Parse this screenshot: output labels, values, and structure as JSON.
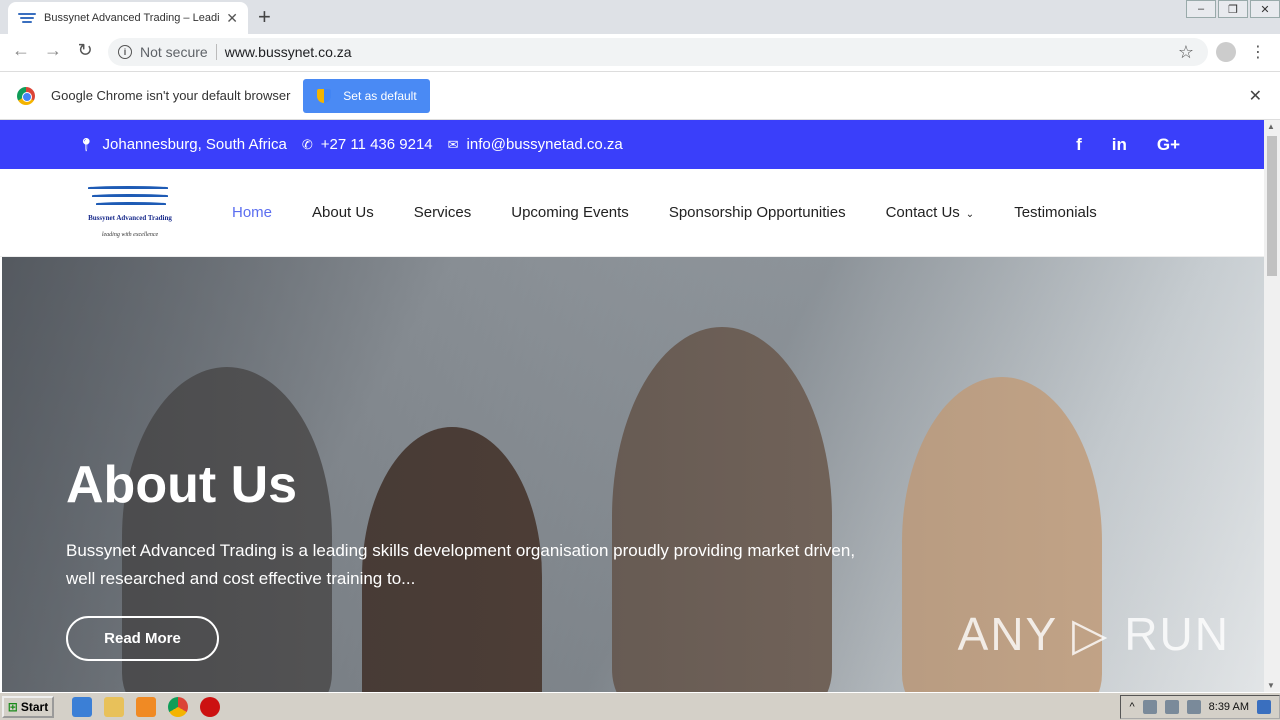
{
  "browser": {
    "tab_title": "Bussynet Advanced Trading – Leadi",
    "tab_close": "✕",
    "new_tab": "+",
    "not_secure": "Not secure",
    "url": "www.bussynet.co.za",
    "window_controls": [
      "–",
      "❐",
      "✕"
    ]
  },
  "infobar": {
    "message": "Google Chrome isn't your default browser",
    "button": "Set as default",
    "close": "✕"
  },
  "site": {
    "topbar": {
      "location": "Johannesburg, South Africa",
      "phone": "+27 11 436 9214",
      "email": "info@bussynetad.co.za",
      "social": [
        "f",
        "in",
        "G+"
      ]
    },
    "logo": {
      "name": "Bussynet Advanced Trading",
      "tagline": "leading with excellence"
    },
    "nav": [
      "Home",
      "About Us",
      "Services",
      "Upcoming Events",
      "Sponsorship Opportunities",
      "Contact Us",
      "Testimonials"
    ],
    "hero": {
      "heading": "About Us",
      "text": "Bussynet Advanced Trading is a leading skills development organisation proudly providing market driven, well researched and cost effective training to...",
      "button": "Read More",
      "watermark": "ANY ▷ RUN"
    }
  },
  "taskbar": {
    "start": "Start",
    "clock": "8:39 AM"
  },
  "colors": {
    "topbar": "#3a3ffa",
    "nav_active": "#5b6ef0",
    "set_default_button": "#4a8af4"
  }
}
